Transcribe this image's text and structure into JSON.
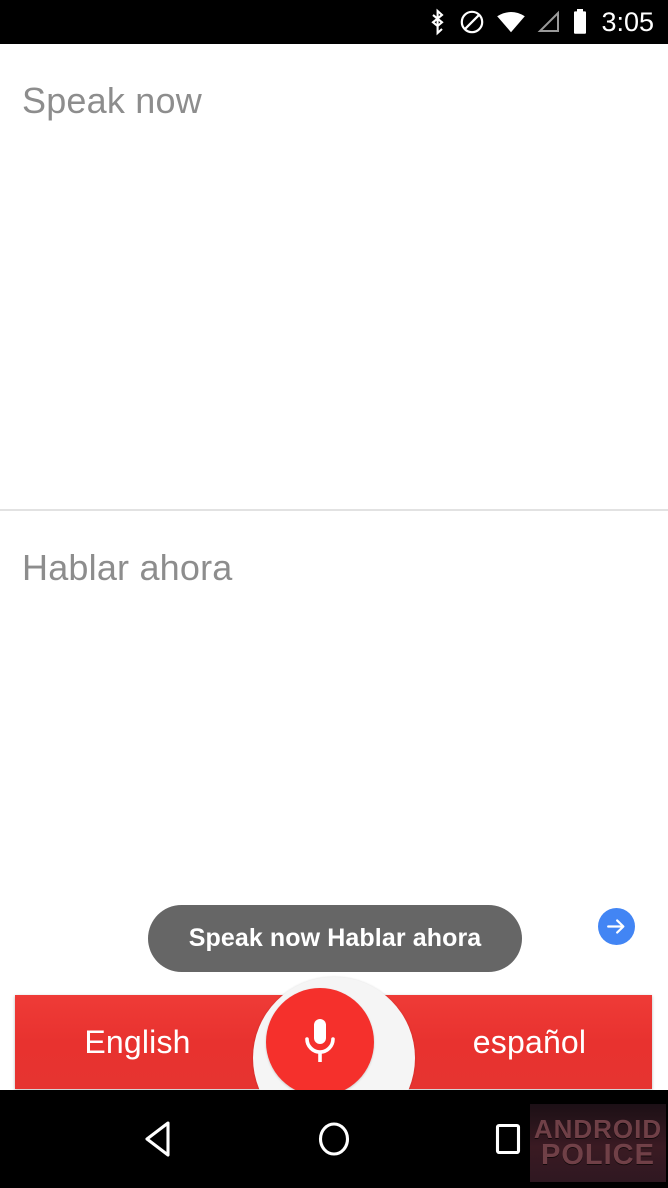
{
  "status_bar": {
    "time": "3:05",
    "icons": [
      {
        "name": "bluetooth-icon",
        "label": "Bluetooth"
      },
      {
        "name": "do-not-disturb-icon",
        "label": "Do not disturb"
      },
      {
        "name": "wifi-icon",
        "label": "Wi-Fi"
      },
      {
        "name": "cellular-signal-icon",
        "label": "Cellular signal"
      },
      {
        "name": "battery-icon",
        "label": "Battery"
      }
    ],
    "background_color": "#000000",
    "foreground_color": "#ffffff"
  },
  "source_panel": {
    "hint": "Speak now",
    "hint_color": "#8d8d8d",
    "value": ""
  },
  "target_panel": {
    "hint": "Hablar ahora",
    "hint_color": "#8d8d8d",
    "value": ""
  },
  "toast": {
    "text": "Speak now Hablar ahora",
    "background_color": "#666666",
    "text_color": "#ffffff"
  },
  "send_button": {
    "icon": "arrow-right-icon",
    "color": "#4285f4",
    "label": "Send"
  },
  "language_bar": {
    "source_language": "English",
    "target_language": "español",
    "background_color": "#e8322f",
    "text_color": "#ffffff"
  },
  "mic_button": {
    "icon": "microphone-icon",
    "color": "#f5302c",
    "ring_color": "#f5f5f5",
    "label": "Microphone"
  },
  "nav_bar": {
    "background_color": "#000000",
    "buttons": [
      {
        "name": "nav-back-button",
        "label": "Back",
        "icon": "triangle-left-icon"
      },
      {
        "name": "nav-home-button",
        "label": "Home",
        "icon": "circle-icon"
      },
      {
        "name": "nav-recents-button",
        "label": "Recents",
        "icon": "square-icon"
      }
    ]
  },
  "watermark": {
    "line1": "ANDROID",
    "line2": "POLICE"
  }
}
